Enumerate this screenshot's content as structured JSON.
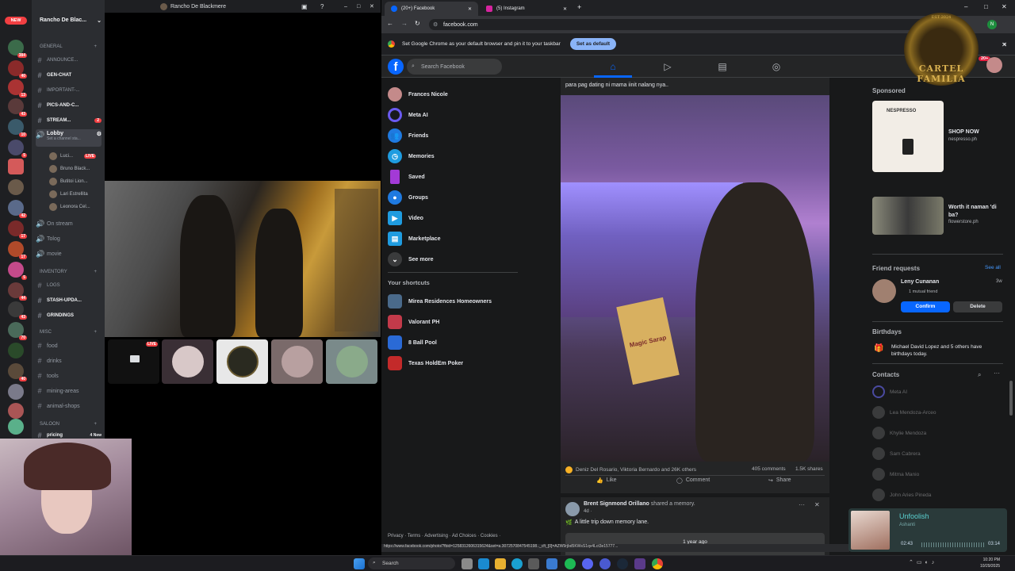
{
  "discord": {
    "server_name": "Rancho De Blac...",
    "window_title": "Rancho De Blackmere",
    "new_badge": "NEW",
    "server_badges": [
      "384",
      "40",
      "13",
      "43",
      "10",
      "5",
      "42",
      "17",
      "17",
      "5",
      "44",
      "43",
      "70",
      "40"
    ],
    "categories": {
      "general": "GENERAL",
      "inventory": "INVENTORY",
      "misc": "MISC",
      "saloon": "SALOON"
    },
    "channels_general": [
      "ANNOUNCE...",
      "GEN-CHAT",
      "IMPORTANT-...",
      "PICS-AND-C...",
      "STREAM..."
    ],
    "stream_badge": "2",
    "lobby": "Lobby",
    "lobby_status": "Set a channel sta...",
    "voice_users": [
      "Luci...",
      "Bruno Black...",
      "Butitoi Lion...",
      "Lari Estrellita",
      "Leonora Cel..."
    ],
    "live_label": "LIVE",
    "voice_channels": [
      "On stream",
      "Tolog",
      "movie"
    ],
    "channels_inventory": [
      "LOGS",
      "STASH-UPDA...",
      "GRINDINGS"
    ],
    "channels_misc": [
      "food",
      "drinks",
      "tools",
      "mining-areas",
      "animal-shops"
    ],
    "channels_saloon": [
      "pricing"
    ],
    "saloon_new": "4 New",
    "thumb_live": "LIVE"
  },
  "chrome": {
    "tabs": [
      "(20+) Facebook",
      "(5) Instagram"
    ],
    "url": "facebook.com",
    "infobar_text": "Set Google Chrome as your default browser and pin it to your taskbar",
    "set_default": "Set as default",
    "status_url": "https://www.facebook.com/photo/?fbid=1258312606315624&set=a.3072570847545198.._cft_[0]=AZW9rjbd5KWsS1qv4Lct3e15777..."
  },
  "facebook": {
    "search_placeholder": "Search Facebook",
    "left_nav": [
      "Frances Nicole",
      "Meta AI",
      "Friends",
      "Memories",
      "Saved",
      "Groups",
      "Video",
      "Marketplace",
      "See more"
    ],
    "shortcuts_title": "Your shortcuts",
    "shortcuts": [
      "Mirea Residences Homeowners",
      "Valorant PH",
      "8 Ball Pool",
      "Texas HoldEm Poker"
    ],
    "footer": "Privacy · Terms · Advertising · Ad Choices · Cookies ·",
    "post": {
      "caption": "para pag dating ni mama iinit nalang nya..",
      "reactions": "Deniz Del Rosario, Viktoria Bernardo and 26K others",
      "comments": "405 comments",
      "shares": "1.5K shares",
      "like": "Like",
      "comment": "Comment",
      "share": "Share",
      "packet_text": "Magic Sarap"
    },
    "post2": {
      "author": "Brent Signmond Orillano",
      "action": "shared a memory.",
      "time": "4d · ",
      "text": "A little trip down memory lane.",
      "memory": "1 year ago"
    },
    "sponsored": "Sponsored",
    "ads": [
      {
        "title": "SHOP NOW",
        "domain": "nespresso.ph",
        "brand": "NESPRESSO"
      },
      {
        "title": "Worth it naman 'di ba?",
        "domain": "flowerstore.ph"
      }
    ],
    "friend_requests": "Friend requests",
    "see_all": "See all",
    "request": {
      "name": "Leny Cunanan",
      "mutual": "1 mutual friend",
      "time": "3w",
      "confirm": "Confirm",
      "delete": "Delete"
    },
    "birthdays_title": "Birthdays",
    "birthdays_text": "Michael David Lopez and 5 others have birthdays today.",
    "contacts_title": "Contacts",
    "contacts": [
      "Meta AI",
      "Lea Mendoza-Arceo",
      "Khylie Mendoza",
      "Sam Cabrera",
      "Mitma Manio",
      "John Aries Pineda"
    ],
    "notif_count": "20+"
  },
  "overlay": {
    "logo_line1": "CARTEL",
    "logo_line2": "FAMILIA",
    "logo_est": "EST 2024"
  },
  "music": {
    "title": "Unfoolish",
    "artist": "Ashanti",
    "elapsed": "02:43",
    "total": "03:14"
  },
  "taskbar": {
    "search": "Search",
    "time": "10:20 PM",
    "date": "10/29/2025"
  }
}
